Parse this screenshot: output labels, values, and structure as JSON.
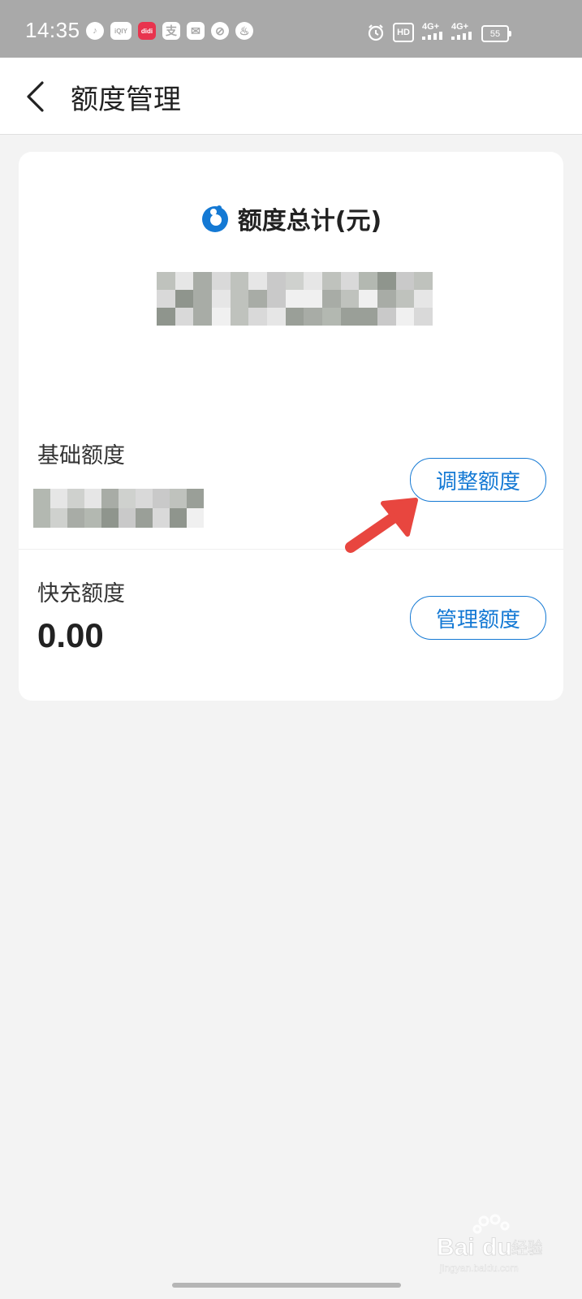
{
  "status_bar": {
    "time": "14:35",
    "notification_icons": [
      "music-icon",
      "iqiyi-icon",
      "didi-icon",
      "alipay-icon",
      "mail-icon",
      "speedometer-icon",
      "fire-icon"
    ],
    "notification_labels": [
      "♪",
      "iQIY",
      "didi",
      "支",
      "✉",
      "⊘",
      "♨"
    ],
    "hd_label": "HD",
    "signal1": "4G+",
    "signal2": "4G+",
    "battery": "55"
  },
  "header": {
    "title": "额度管理"
  },
  "card": {
    "total_label": "额度总计(元)",
    "base_label": "基础额度",
    "adjust_button": "调整额度",
    "quick_label": "快充额度",
    "quick_value": "0.00",
    "manage_button": "管理额度"
  },
  "colors": {
    "accent": "#1479d4",
    "status_bar": "#a9a9a9",
    "background": "#f3f3f3",
    "arrow": "#e8463f"
  },
  "watermark": {
    "brand": "Bai du 经验",
    "url": "jingyan.baidu.com"
  }
}
